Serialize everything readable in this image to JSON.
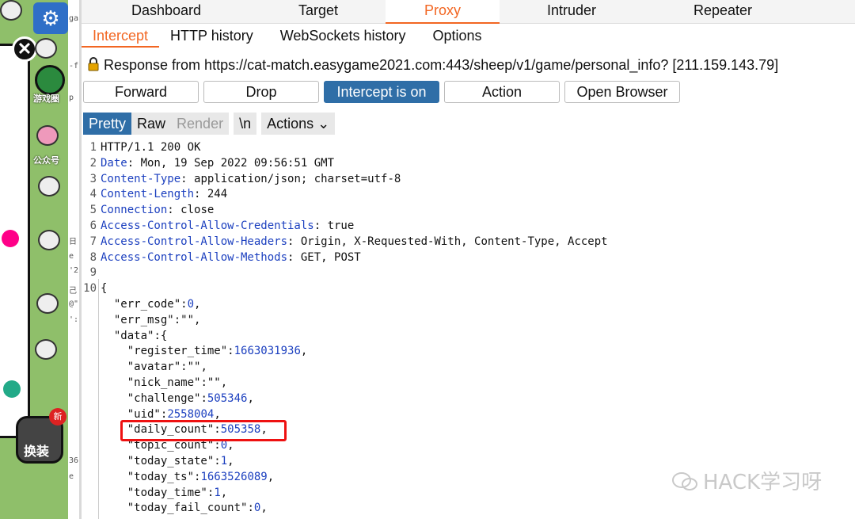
{
  "game": {
    "labels": {
      "game_circle": "游戏圈",
      "official_account": "公众号",
      "swap": "换装",
      "new_badge": "新"
    }
  },
  "code_peek": [
    "ga",
    "-f",
    "p",
    "日",
    "e",
    "'2",
    "己",
    "@\"",
    "':",
    "36",
    "e"
  ],
  "main_tabs": [
    {
      "label": "Dashboard"
    },
    {
      "label": "Target"
    },
    {
      "label": "Proxy"
    },
    {
      "label": "Intruder"
    },
    {
      "label": "Repeater"
    }
  ],
  "sub_tabs": [
    {
      "label": "Intercept"
    },
    {
      "label": "HTTP history"
    },
    {
      "label": "WebSockets history"
    },
    {
      "label": "Options"
    }
  ],
  "info_bar": "Response from https://cat-match.easygame2021.com:443/sheep/v1/game/personal_info?  [211.159.143.79]",
  "buttons": {
    "forward": "Forward",
    "drop": "Drop",
    "intercept": "Intercept is on",
    "action": "Action",
    "open_browser": "Open Browser"
  },
  "view_tabs": {
    "pretty": "Pretty",
    "raw": "Raw",
    "render": "Render",
    "newline": "\\n",
    "actions": "Actions"
  },
  "response": {
    "headers": [
      {
        "n": "1",
        "k": "HTTP/1.1 200 OK",
        "v": ""
      },
      {
        "n": "2",
        "k": "Date",
        "v": ": Mon, 19 Sep 2022 09:56:51 GMT"
      },
      {
        "n": "3",
        "k": "Content-Type",
        "v": ": application/json; charset=utf-8"
      },
      {
        "n": "4",
        "k": "Content-Length",
        "v": ": 244"
      },
      {
        "n": "5",
        "k": "Connection",
        "v": ": close"
      },
      {
        "n": "6",
        "k": "Access-Control-Allow-Credentials",
        "v": ": true"
      },
      {
        "n": "7",
        "k": "Access-Control-Allow-Headers",
        "v": ": Origin, X-Requested-With, Content-Type, Accept"
      },
      {
        "n": "8",
        "k": "Access-Control-Allow-Methods",
        "v": ": GET, POST"
      },
      {
        "n": "9",
        "k": "",
        "v": ""
      }
    ],
    "body_lines": [
      {
        "n": "10",
        "indent": "",
        "key": "{",
        "val": "",
        "tail": ""
      },
      {
        "n": "",
        "indent": "  ",
        "key": "\"err_code\"",
        "val": "0",
        "tail": ","
      },
      {
        "n": "",
        "indent": "  ",
        "key": "\"err_msg\"",
        "val": "\"\"",
        "tail": ","
      },
      {
        "n": "",
        "indent": "  ",
        "key": "\"data\"",
        "val": "{",
        "tail": ""
      },
      {
        "n": "",
        "indent": "    ",
        "key": "\"register_time\"",
        "val": "1663031936",
        "tail": ","
      },
      {
        "n": "",
        "indent": "    ",
        "key": "\"avatar\"",
        "val": "\"\"",
        "tail": ","
      },
      {
        "n": "",
        "indent": "    ",
        "key": "\"nick_name\"",
        "val": "\"\"",
        "tail": ","
      },
      {
        "n": "",
        "indent": "    ",
        "key": "\"challenge\"",
        "val": "505346",
        "tail": ","
      },
      {
        "n": "",
        "indent": "    ",
        "key": "\"uid\"",
        "val": "2558004",
        "tail": ","
      },
      {
        "n": "",
        "indent": "    ",
        "key": "\"daily_count\"",
        "val": "505358",
        "tail": ","
      },
      {
        "n": "",
        "indent": "    ",
        "key": "\"topic_count\"",
        "val": "0",
        "tail": ","
      },
      {
        "n": "",
        "indent": "    ",
        "key": "\"today_state\"",
        "val": "1",
        "tail": ","
      },
      {
        "n": "",
        "indent": "    ",
        "key": "\"today_ts\"",
        "val": "1663526089",
        "tail": ","
      },
      {
        "n": "",
        "indent": "    ",
        "key": "\"today_time\"",
        "val": "1",
        "tail": ","
      },
      {
        "n": "",
        "indent": "    ",
        "key": "\"today_fail_count\"",
        "val": "0",
        "tail": ","
      }
    ]
  },
  "watermark": "HACK学习呀",
  "colors": {
    "accent": "#f26622",
    "button_on": "#2f6ea7",
    "key_blue": "#1b3fbf",
    "highlight_box": "#e11111"
  }
}
